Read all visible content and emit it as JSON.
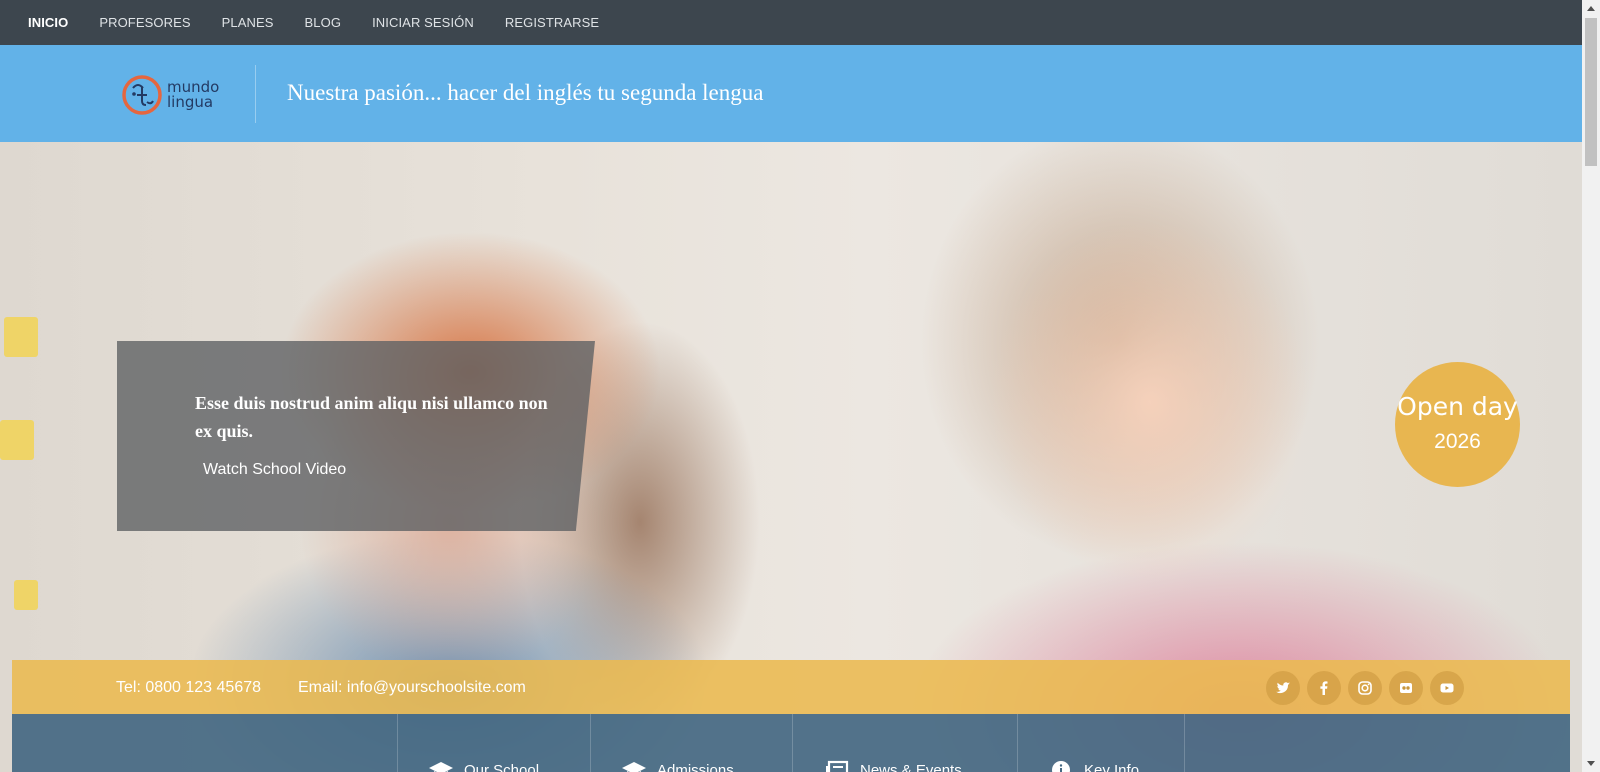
{
  "nav": {
    "items": [
      {
        "label": "INICIO",
        "active": true
      },
      {
        "label": "PROFESORES"
      },
      {
        "label": "PLANES"
      },
      {
        "label": "BLOG"
      },
      {
        "label": "INICIAR SESIÓN"
      },
      {
        "label": "REGISTRARSE"
      }
    ]
  },
  "header": {
    "logo_line1": "mundo",
    "logo_line2": "lingua",
    "tagline": "Nuestra pasión... hacer del inglés tu segunda lengua"
  },
  "hero": {
    "headline": "Esse duis nostrud anim aliqu nisi ullamco non ex quis.",
    "video_link": "Watch School Video",
    "badge_label": "Open day",
    "badge_year": "2026"
  },
  "contact": {
    "tel": "Tel: 0800 123 45678",
    "email": "Email: info@yourschoolsite.com",
    "socials": [
      "twitter-icon",
      "facebook-icon",
      "instagram-icon",
      "flickr-icon",
      "youtube-icon"
    ]
  },
  "infobar": {
    "items": [
      {
        "label": "Our School",
        "icon": "graduation-cap-icon"
      },
      {
        "label": "Admissions",
        "icon": "mortarboard-icon"
      },
      {
        "label": "News & Events",
        "icon": "newspaper-icon"
      },
      {
        "label": "Key Info",
        "icon": "info-icon"
      }
    ]
  },
  "colors": {
    "nav_bg": "#3d464e",
    "header_bg": "#62b2e8",
    "accent_yellow": "#e8b650",
    "info_bar": "#446882"
  }
}
